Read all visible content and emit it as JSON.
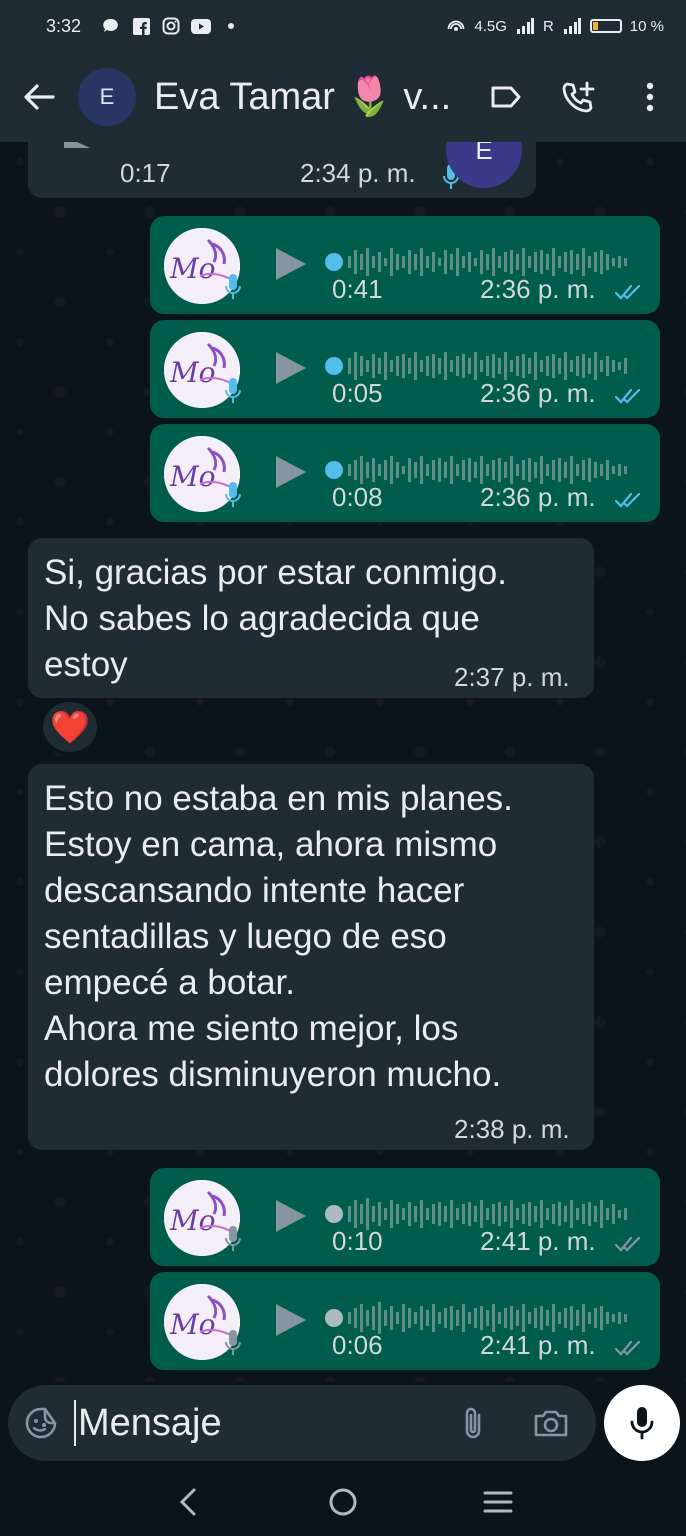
{
  "status_bar": {
    "time": "3:32",
    "network": "4.5G",
    "roaming": "R",
    "battery": "10 %"
  },
  "header": {
    "avatar_letter": "E",
    "title": "Eva Tamar 🌷 v...",
    "icons": [
      "back-arrow-icon",
      "label-icon",
      "add-call-icon",
      "more-vert-icon"
    ]
  },
  "messages": {
    "partial_voice": {
      "duration": "0:17",
      "time": "2:34 p. m.",
      "avatar_letter": "E"
    },
    "voice_1": {
      "duration": "0:41",
      "time": "2:36 p. m."
    },
    "voice_2": {
      "duration": "0:05",
      "time": "2:36 p. m."
    },
    "voice_3": {
      "duration": "0:08",
      "time": "2:36 p. m."
    },
    "text_1": {
      "lines": [
        "Si, gracias por estar conmigo.",
        "No sabes lo agradecida que",
        "estoy"
      ],
      "time": "2:37 p. m."
    },
    "reaction": "❤️",
    "text_2": {
      "lines": [
        "Esto no estaba en mis planes.",
        "Estoy en cama, ahora mismo",
        "descansando intente hacer",
        "sentadillas y luego de eso",
        "empecé a botar.",
        "Ahora me siento mejor, los",
        "dolores disminuyeron mucho."
      ],
      "time": "2:38 p. m."
    },
    "voice_4": {
      "duration": "0:10",
      "time": "2:41 p. m."
    },
    "voice_5": {
      "duration": "0:06",
      "time": "2:41 p. m."
    }
  },
  "composer": {
    "placeholder": "Mensaje"
  },
  "colors": {
    "incoming_bubble": "#1f2c34",
    "outgoing_bubble": "#005c4b",
    "read_ticks": "#53bdeb",
    "delivered_ticks": "#8696a0",
    "background": "#0b141a"
  }
}
